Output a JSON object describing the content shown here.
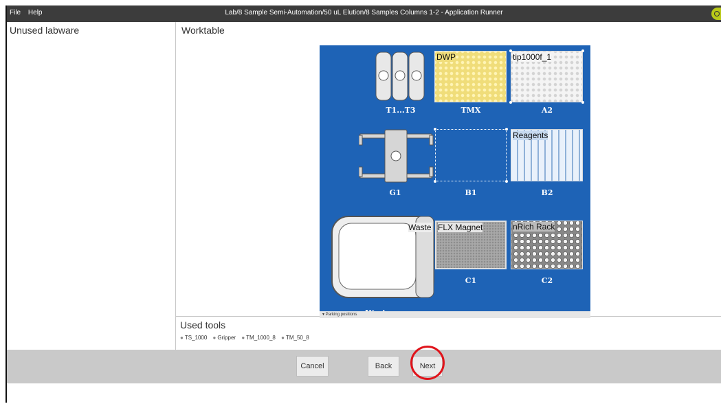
{
  "menu": {
    "file": "File",
    "help": "Help"
  },
  "window_title": "Lab/8 Sample Semi-Automation/50 uL Elution/8 Samples Columns 1-2 - Application Runner",
  "panels": {
    "unused": "Unused labware",
    "worktable": "Worktable",
    "used_tools": "Used tools"
  },
  "deck": {
    "slots": [
      "T1...T3",
      "TMX",
      "A2",
      "G1",
      "B1",
      "B2",
      "C1",
      "C2",
      "Waste"
    ],
    "labware": {
      "tmx": "DWP",
      "a2": "tip1000f_1",
      "b2": "Reagents",
      "waste": "Waste",
      "c1": "FLX Magnet",
      "c2": "nRich Rack"
    },
    "parking": "Parking positions"
  },
  "tools": [
    "TS_1000",
    "Gripper",
    "TM_1000_8",
    "TM_50_8"
  ],
  "buttons": {
    "cancel": "Cancel",
    "back": "Back",
    "next": "Next"
  },
  "colors": {
    "deck": "#1e63b6",
    "highlight": "#e0141b",
    "titlebar": "#3c3c3c"
  }
}
